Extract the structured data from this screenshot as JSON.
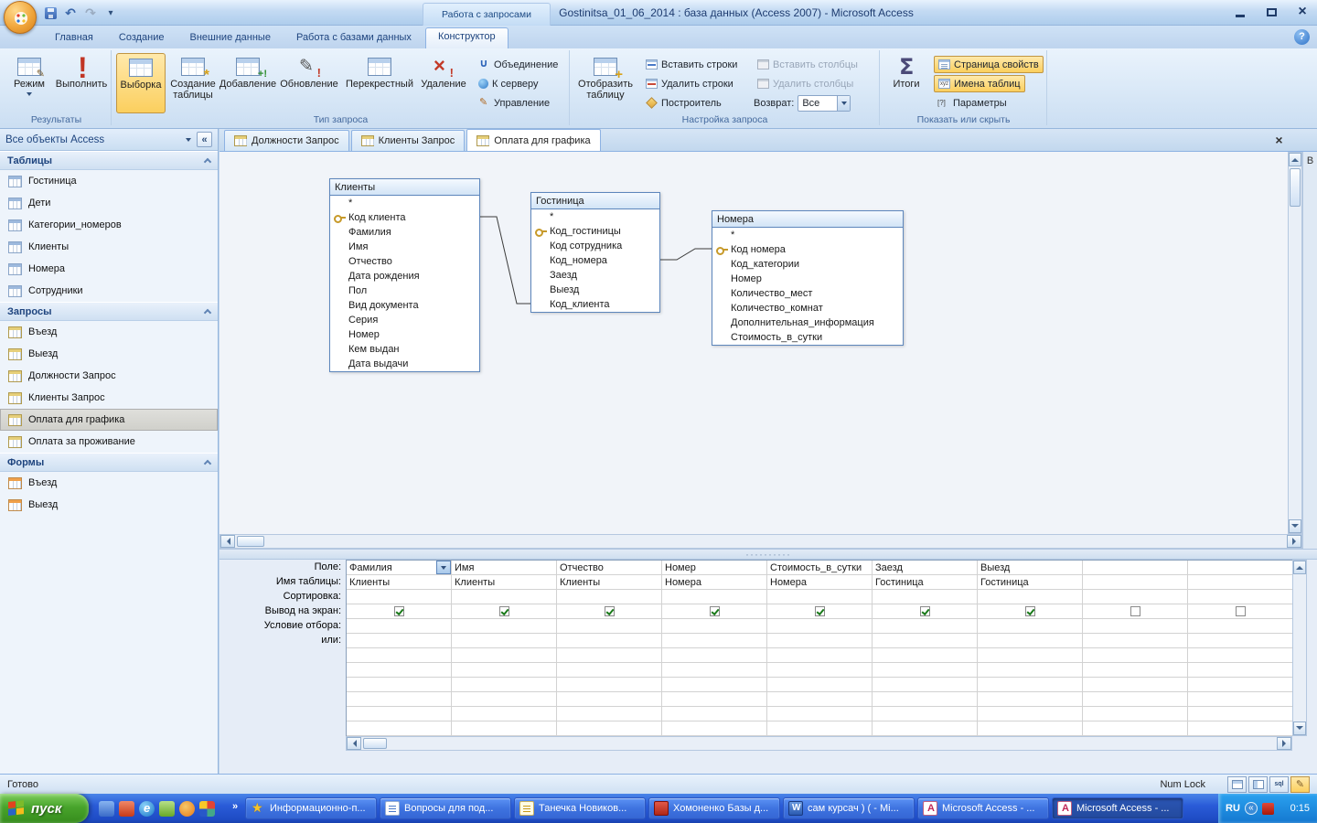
{
  "window": {
    "title": "Gostinitsa_01_06_2014 : база данных (Access 2007) - Microsoft Access",
    "context_tab_group": "Работа с запросами"
  },
  "ribbon": {
    "tabs": [
      "Главная",
      "Создание",
      "Внешние данные",
      "Работа с базами данных",
      "Конструктор"
    ],
    "active_tab": "Конструктор",
    "groups": {
      "results": {
        "label": "Результаты",
        "mode": "Режим",
        "run": "Выполнить"
      },
      "query_type": {
        "label": "Тип запроса",
        "select": "Выборка",
        "make_table": "Создание таблицы",
        "append": "Добавление",
        "update": "Обновление",
        "crosstab": "Перекрестный",
        "delete": "Удаление",
        "union": "Объединение",
        "pass_through": "К серверу",
        "data_definition": "Управление"
      },
      "query_setup": {
        "label": "Настройка запроса",
        "show_table": "Отобразить таблицу",
        "insert_rows": "Вставить строки",
        "delete_rows": "Удалить строки",
        "builder": "Построитель",
        "insert_columns": "Вставить столбцы",
        "delete_columns": "Удалить столбцы",
        "return_label": "Возврат:",
        "return_value": "Все"
      },
      "show_hide": {
        "label": "Показать или скрыть",
        "totals": "Итоги",
        "property_sheet": "Страница свойств",
        "table_names": "Имена таблиц",
        "parameters": "Параметры"
      }
    }
  },
  "sidebar": {
    "title": "Все объекты Access",
    "sections": [
      {
        "label": "Таблицы",
        "icon": "table-icon",
        "items": [
          "Гостиница",
          "Дети",
          "Категории_номеров",
          "Клиенты",
          "Номера",
          "Сотрудники"
        ]
      },
      {
        "label": "Запросы",
        "icon": "query-icon",
        "selected": "Оплата для графика",
        "items": [
          "Въезд",
          "Выезд",
          "Должности Запрос",
          "Клиенты Запрос",
          "Оплата для графика",
          "Оплата за проживание"
        ]
      },
      {
        "label": "Формы",
        "icon": "form-icon",
        "items": [
          "Въезд",
          "Выезд"
        ]
      }
    ]
  },
  "document_tabs": [
    "Должности Запрос",
    "Клиенты Запрос",
    "Оплата для графика"
  ],
  "active_document_tab": "Оплата для графика",
  "design": {
    "right_strip_label": "В",
    "tables": [
      {
        "name": "Клиенты",
        "key_field": "Код клиента",
        "fields": [
          "*",
          "Код клиента",
          "Фамилия",
          "Имя",
          "Отчество",
          "Дата рождения",
          "Пол",
          "Вид документа",
          "Серия",
          "Номер",
          "Кем выдан",
          "Дата выдачи"
        ]
      },
      {
        "name": "Гостиница",
        "key_field": "Код_гостиницы",
        "fields": [
          "*",
          "Код_гостиницы",
          "Код сотрудника",
          "Код_номера",
          "Заезд",
          "Выезд",
          "Код_клиента"
        ]
      },
      {
        "name": "Номера",
        "key_field": "Код номера",
        "fields": [
          "*",
          "Код номера",
          "Код_категории",
          "Номер",
          "Количество_мест",
          "Количество_комнат",
          "Дополнительная_информация",
          "Стоимость_в_сутки"
        ]
      }
    ]
  },
  "grid": {
    "row_labels": [
      "Поле:",
      "Имя таблицы:",
      "Сортировка:",
      "Вывод на экран:",
      "Условие отбора:",
      "или:"
    ],
    "columns": [
      {
        "field": "Фамилия",
        "table": "Клиенты",
        "show": true
      },
      {
        "field": "Имя",
        "table": "Клиенты",
        "show": true
      },
      {
        "field": "Отчество",
        "table": "Клиенты",
        "show": true
      },
      {
        "field": "Номер",
        "table": "Номера",
        "show": true
      },
      {
        "field": "Стоимость_в_сутки",
        "table": "Номера",
        "show": true
      },
      {
        "field": "Заезд",
        "table": "Гостиница",
        "show": true
      },
      {
        "field": "Выезд",
        "table": "Гостиница",
        "show": true
      },
      {
        "field": "",
        "table": "",
        "show": false
      },
      {
        "field": "",
        "table": "",
        "show": false
      }
    ]
  },
  "status_bar": {
    "left": "Готово",
    "num_lock": "Num Lock"
  },
  "taskbar": {
    "start": "пуск",
    "quick_launch": [
      "quick-launch-1",
      "quick-launch-2",
      "quick-launch-3",
      "quick-launch-4",
      "quick-launch-5",
      "quick-launch-6"
    ],
    "buttons": [
      "Информационно-п...",
      "Вопросы для под...",
      "Танечка Новиков...",
      "Хомоненко Базы д...",
      "сам курсач ) ( - Mi...",
      "Microsoft Access - ...",
      "Microsoft Access - ..."
    ],
    "button_icons": [
      "star",
      "document-blue",
      "document-yellow",
      "book-red",
      "word",
      "access",
      "access"
    ],
    "active_button_index": 6,
    "tray": {
      "lang": "RU",
      "time": "0:15"
    }
  },
  "colors": {
    "highlight_orange": "#FBCF5E",
    "ribbon_blue": "#DCE9F7",
    "title_bar_blue": "#C3DAF3",
    "taskbar_blue": "#2A5CD8",
    "start_green": "#48A42C",
    "selection_gray": "#D5D5D0",
    "table_header_blue": "#D2E4F6"
  }
}
